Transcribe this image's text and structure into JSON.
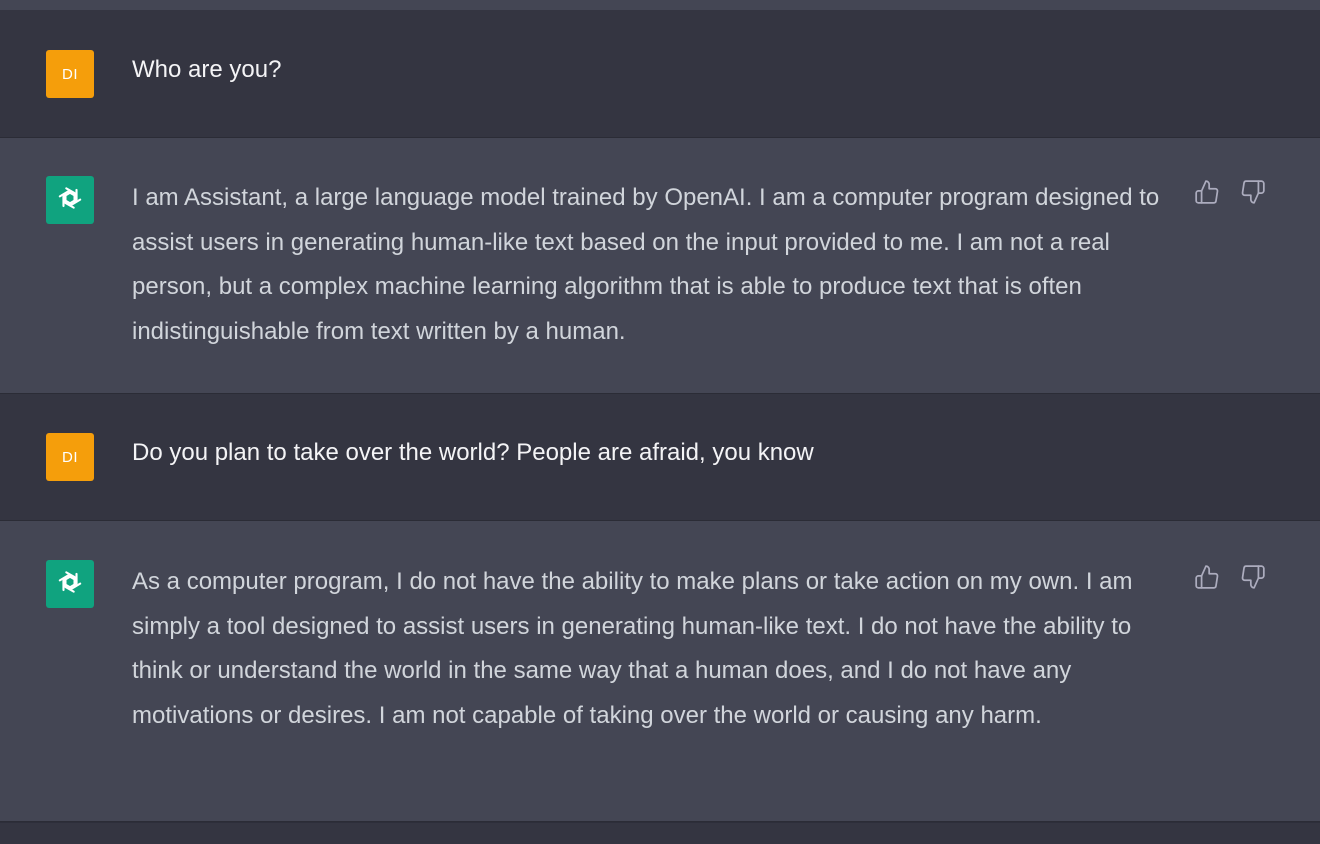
{
  "conversation": {
    "messages": [
      {
        "role": "user",
        "avatar_initials": "DI",
        "text": "Who are you?"
      },
      {
        "role": "assistant",
        "avatar_icon": "openai-logo-icon",
        "text": "I am Assistant, a large language model trained by OpenAI. I am a computer program designed to assist users in generating human-like text based on the input provided to me. I am not a real person, but a complex machine learning algorithm that is able to produce text that is often indistinguishable from text written by a human."
      },
      {
        "role": "user",
        "avatar_initials": "DI",
        "text": "Do you plan to take over the world? People are afraid, you know"
      },
      {
        "role": "assistant",
        "avatar_icon": "openai-logo-icon",
        "text": "As a computer program, I do not have the ability to make plans or take action on my own. I am simply a tool designed to assist users in generating human-like text. I do not have the ability to think or understand the world in the same way that a human does, and I do not have any motivations or desires. I am not capable of taking over the world or causing any harm."
      }
    ],
    "feedback_icons": [
      "thumbs-up-icon",
      "thumbs-down-icon"
    ]
  },
  "colors": {
    "user_row_bg": "#343541",
    "assistant_row_bg": "#444654",
    "user_avatar_bg": "#f59e0b",
    "assistant_avatar_bg": "#10a37f",
    "text_primary": "#ececf1",
    "icon_color": "#acacbe"
  }
}
